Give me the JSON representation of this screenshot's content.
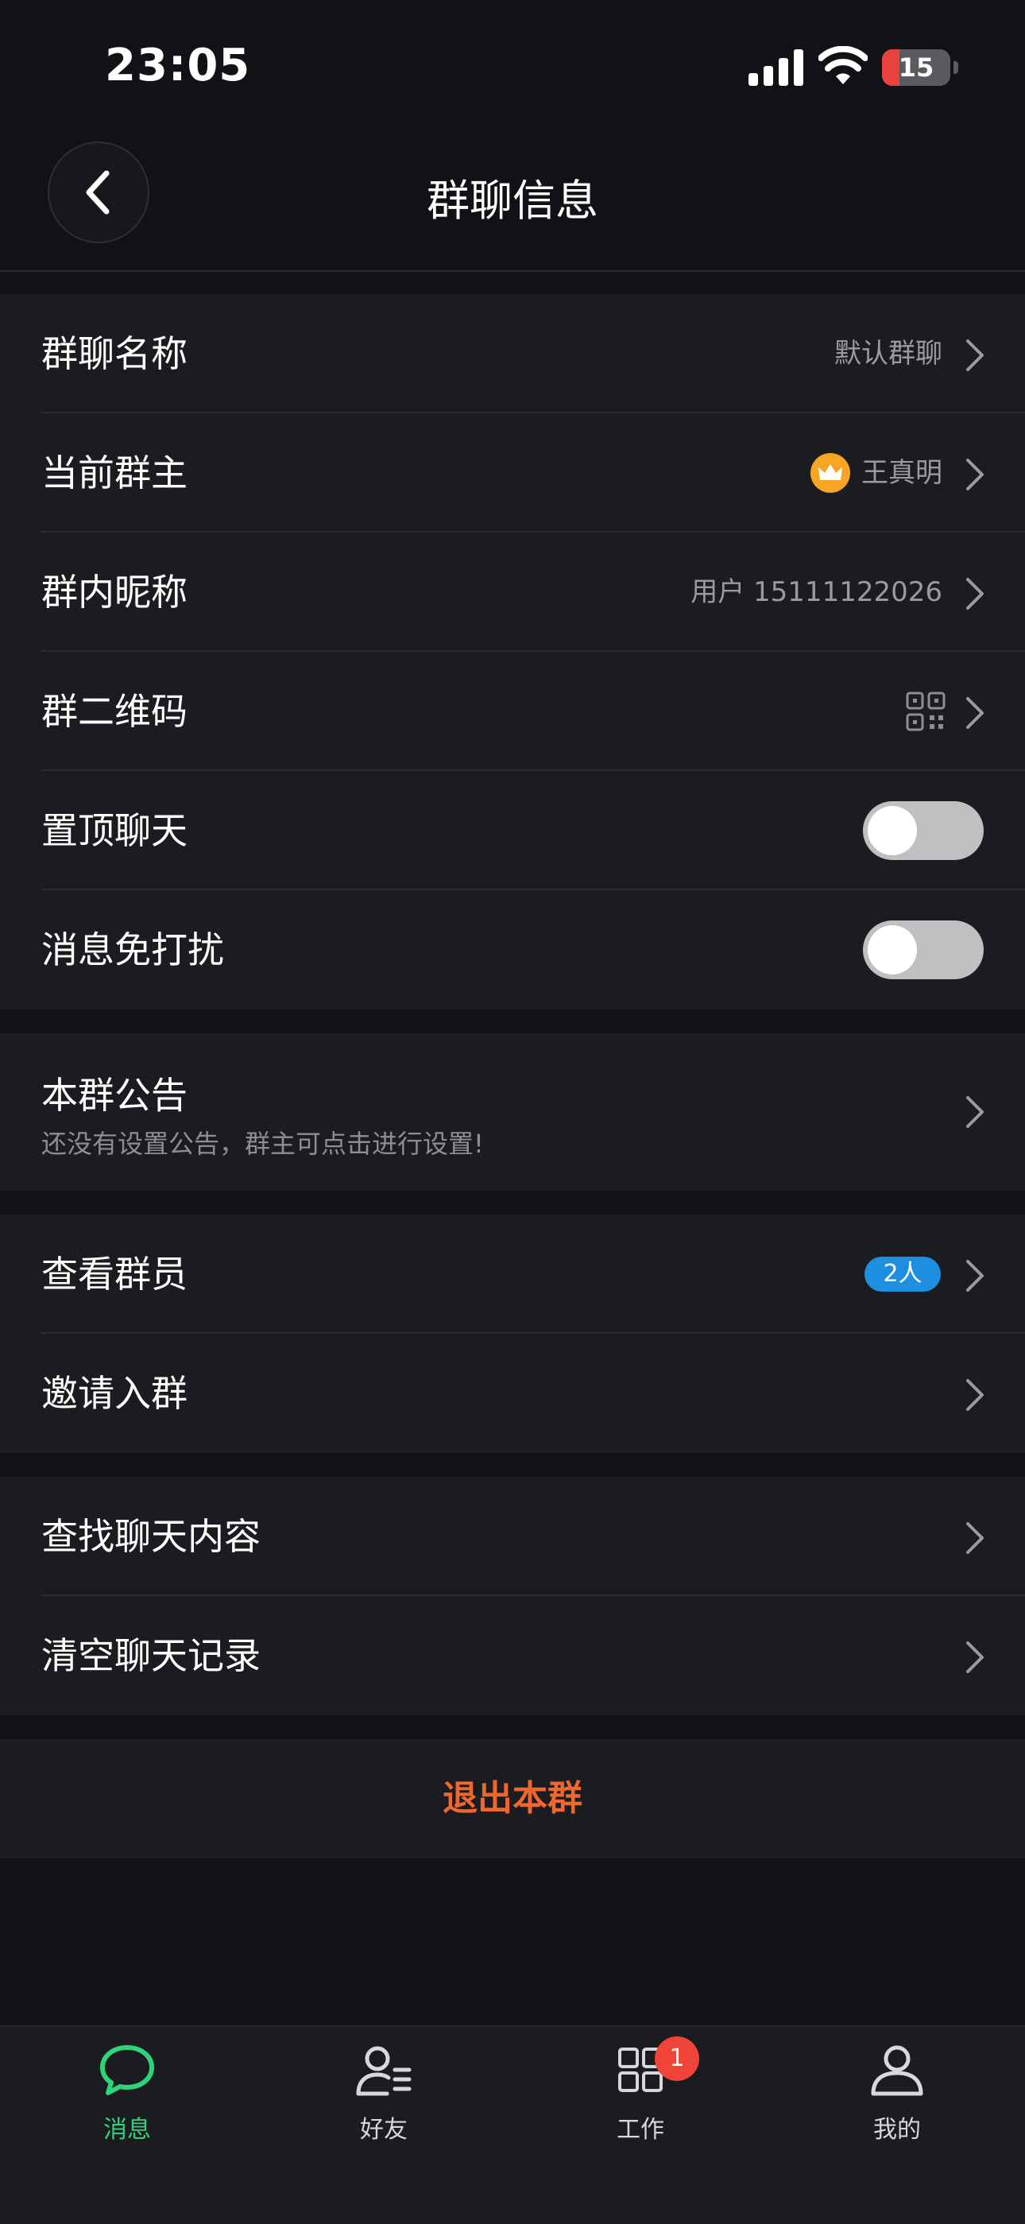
{
  "status_bar": {
    "time": "23:05",
    "battery": "15"
  },
  "header": {
    "title": "群聊信息"
  },
  "settings": {
    "group_name": {
      "label": "群聊名称",
      "value": "默认群聊"
    },
    "owner": {
      "label": "当前群主",
      "value": "王真明"
    },
    "nickname": {
      "label": "群内昵称",
      "value": "用户 15111122026"
    },
    "qr_code": {
      "label": "群二维码"
    },
    "pin_chat": {
      "label": "置顶聊天",
      "on": false
    },
    "mute": {
      "label": "消息免打扰",
      "on": false
    }
  },
  "notice": {
    "title": "本群公告",
    "subtitle": "还没有设置公告，群主可点击进行设置!"
  },
  "members": {
    "view": {
      "label": "查看群员",
      "badge": "2人"
    },
    "invite": {
      "label": "邀请入群"
    }
  },
  "history": {
    "search": {
      "label": "查找聊天内容"
    },
    "clear": {
      "label": "清空聊天记录"
    }
  },
  "exit": {
    "label": "退出本群",
    "color": "#f0672e"
  },
  "tabbar": {
    "items": [
      {
        "label": "消息",
        "icon": "chat-bubble-icon",
        "active": true
      },
      {
        "label": "好友",
        "icon": "contacts-icon"
      },
      {
        "label": "工作",
        "icon": "grid-apps-icon",
        "badge": "1"
      },
      {
        "label": "我的",
        "icon": "profile-icon"
      }
    ],
    "active_color": "#2ed47a"
  }
}
